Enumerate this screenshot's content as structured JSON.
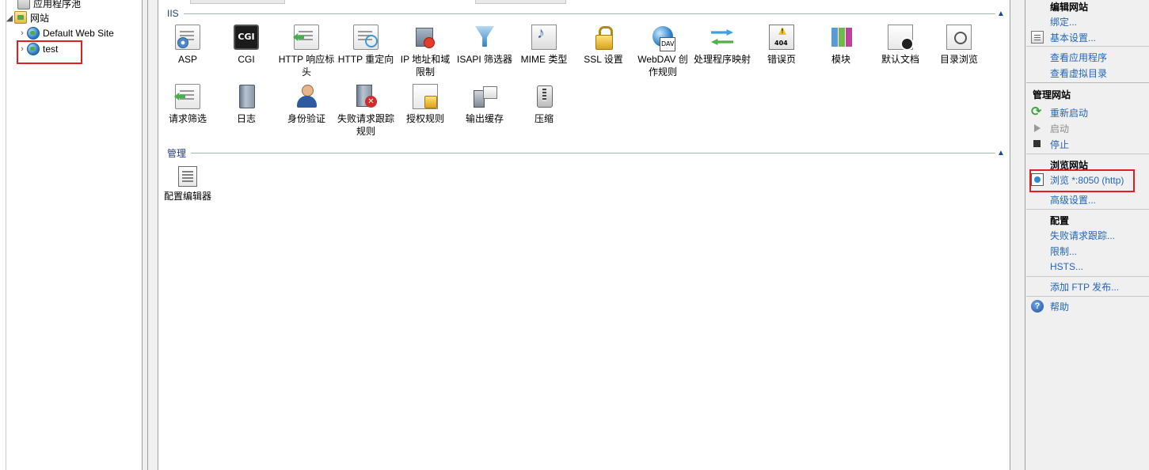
{
  "tree": {
    "items": [
      {
        "label": "应用程序池",
        "icon": "app-pool-icon"
      },
      {
        "label": "网站",
        "icon": "sites-folder-icon"
      },
      {
        "label": "Default Web Site",
        "icon": "globe-icon"
      },
      {
        "label": "test",
        "icon": "globe-icon"
      }
    ]
  },
  "features": {
    "iis_label": "IIS",
    "manage_label": "管理",
    "iis": [
      {
        "label": "ASP",
        "icon": "asp-icon"
      },
      {
        "label": "CGI",
        "icon": "cgi-icon",
        "icon_text": "CGI"
      },
      {
        "label": "HTTP 响应标头",
        "icon": "http-response-headers-icon"
      },
      {
        "label": "HTTP 重定向",
        "icon": "http-redirect-icon"
      },
      {
        "label": "IP 地址和域限制",
        "icon": "ip-restrictions-icon"
      },
      {
        "label": "ISAPI 筛选器",
        "icon": "isapi-filters-icon"
      },
      {
        "label": "MIME 类型",
        "icon": "mime-types-icon"
      },
      {
        "label": "SSL 设置",
        "icon": "ssl-lock-icon"
      },
      {
        "label": "WebDAV 创作规则",
        "icon": "webdav-icon"
      },
      {
        "label": "处理程序映射",
        "icon": "handler-mappings-icon"
      },
      {
        "label": "错误页",
        "icon": "error-pages-icon"
      },
      {
        "label": "模块",
        "icon": "modules-icon"
      },
      {
        "label": "默认文档",
        "icon": "default-document-icon"
      },
      {
        "label": "目录浏览",
        "icon": "directory-browsing-icon"
      },
      {
        "label": "请求筛选",
        "icon": "request-filtering-icon"
      },
      {
        "label": "日志",
        "icon": "logging-icon"
      },
      {
        "label": "身份验证",
        "icon": "authentication-icon"
      },
      {
        "label": "失败请求跟踪规则",
        "icon": "failed-request-tracing-icon"
      },
      {
        "label": "授权规则",
        "icon": "authorization-rules-icon"
      },
      {
        "label": "输出缓存",
        "icon": "output-caching-icon"
      },
      {
        "label": "压缩",
        "icon": "compression-icon"
      }
    ],
    "manage": [
      {
        "label": "配置编辑器",
        "icon": "configuration-editor-icon"
      }
    ]
  },
  "actions": {
    "edit_site_header": "编辑网站",
    "bindings": "绑定...",
    "basic_settings": "基本设置...",
    "view_applications": "查看应用程序",
    "view_virtual_dirs": "查看虚拟目录",
    "manage_site_header": "管理网站",
    "restart": "重新启动",
    "start": "启动",
    "stop": "停止",
    "browse_header": "浏览网站",
    "browse_link": "浏览 *:8050 (http)",
    "advanced_settings": "高级设置...",
    "config_header": "配置",
    "failed_request_tracing": "失败请求跟踪...",
    "limits": "限制...",
    "hsts": "HSTS...",
    "add_ftp": "添加 FTP 发布...",
    "help": "帮助"
  },
  "colors": {
    "link": "#2265b8",
    "highlight_box": "#e02020",
    "group_rule": "#9fb4d6"
  }
}
